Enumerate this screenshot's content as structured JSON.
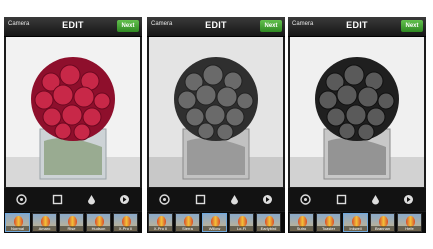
{
  "panels": [
    {
      "camera_label": "Camera",
      "title": "EDIT",
      "next_label": "Next",
      "flower_color": "#b01835",
      "filters": [
        "Normal",
        "Amaro",
        "Rise",
        "Hudson",
        "X-Pro II"
      ]
    },
    {
      "camera_label": "Camera",
      "title": "EDIT",
      "next_label": "Next",
      "flower_color": "#555555",
      "filters": [
        "X-Pro II",
        "Sierra",
        "Willow",
        "Lo-Fi",
        "Earlybird"
      ]
    },
    {
      "camera_label": "Camera",
      "title": "EDIT",
      "next_label": "Next",
      "flower_color": "#4a4a4a",
      "filters": [
        "Sutro",
        "Toaster",
        "Inkwell",
        "Brannan",
        "Hefe"
      ]
    }
  ],
  "selected_filter": {
    "panel_1": 0,
    "panel_2": 2,
    "panel_3": 2
  },
  "icons": [
    "rotate-icon",
    "border-icon",
    "tilt-shift-icon",
    "lux-icon"
  ]
}
